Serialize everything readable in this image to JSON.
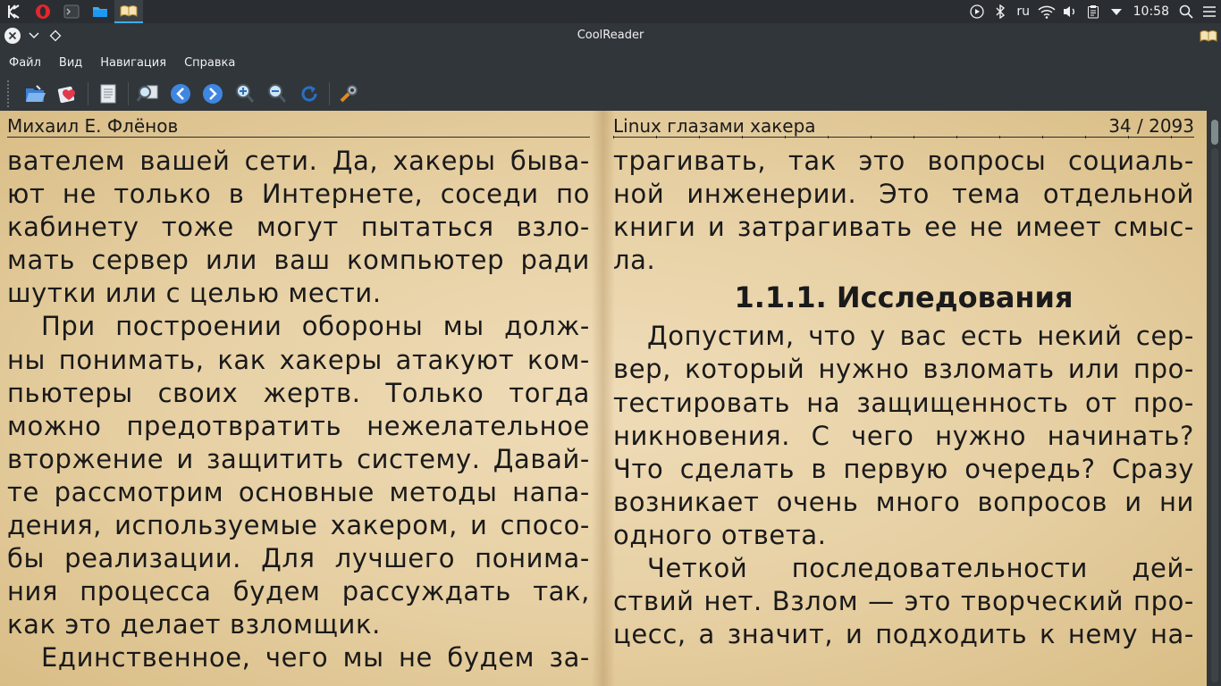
{
  "panel": {
    "language": "ru",
    "clock": "10:58"
  },
  "window": {
    "title": "CoolReader"
  },
  "menu": [
    "Файл",
    "Вид",
    "Навигация",
    "Справка"
  ],
  "toolbar": {
    "icons": [
      "open-file-icon",
      "recent-books-icon",
      "table-of-contents-icon",
      "find-icon",
      "back-icon",
      "forward-icon",
      "zoom-in-icon",
      "zoom-out-icon",
      "rotate-icon",
      "settings-icon"
    ]
  },
  "book": {
    "left_header": "Михаил Е. Флёнов",
    "right_header": "Linux глазами хакера",
    "page_position": "34 / 2093",
    "left_lines": [
      "вателем вашей сети. Да, хакеры быва-",
      "ют не только в Интернете, соседи по",
      "кабинету тоже могут пытаться взло-",
      "мать сервер или ваш компьютер ради",
      "шутки или с целью мести.",
      "При построении обороны мы долж-",
      "ны понимать, как хакеры атакуют ком-",
      "пьютеры своих жертв. Только тогда",
      "можно предотвратить нежелательное",
      "вторжение и защитить систему. Давай-",
      "те рассмотрим основные методы напа-",
      "дения, используемые хакером, и спосо-",
      "бы реализации. Для лучшего понима-",
      "ния процесса будем рассуждать так,",
      "как это делает взломщик.",
      "Единственное, чего мы не будем за-"
    ],
    "right_lines_before": [
      "трагивать, так это вопросы социаль-",
      "ной инженерии. Это тема отдельной",
      "книги и затрагивать ее не имеет смыс-",
      "ла."
    ],
    "heading": "1.1.1. Исследования",
    "right_lines_after": [
      "Допустим, что у вас есть некий сер-",
      "вер, который нужно взломать или про-",
      "тестировать на защищенность от про-",
      "никновения. С чего нужно начинать?",
      "Что сделать в первую очередь? Сразу",
      "возникает очень много вопросов и ни",
      "одного ответа.",
      "Четкой последовательности дей-",
      "ствий нет. Взлом — это творческий про-",
      "цесс, а значит, и подходить к нему на-"
    ]
  }
}
